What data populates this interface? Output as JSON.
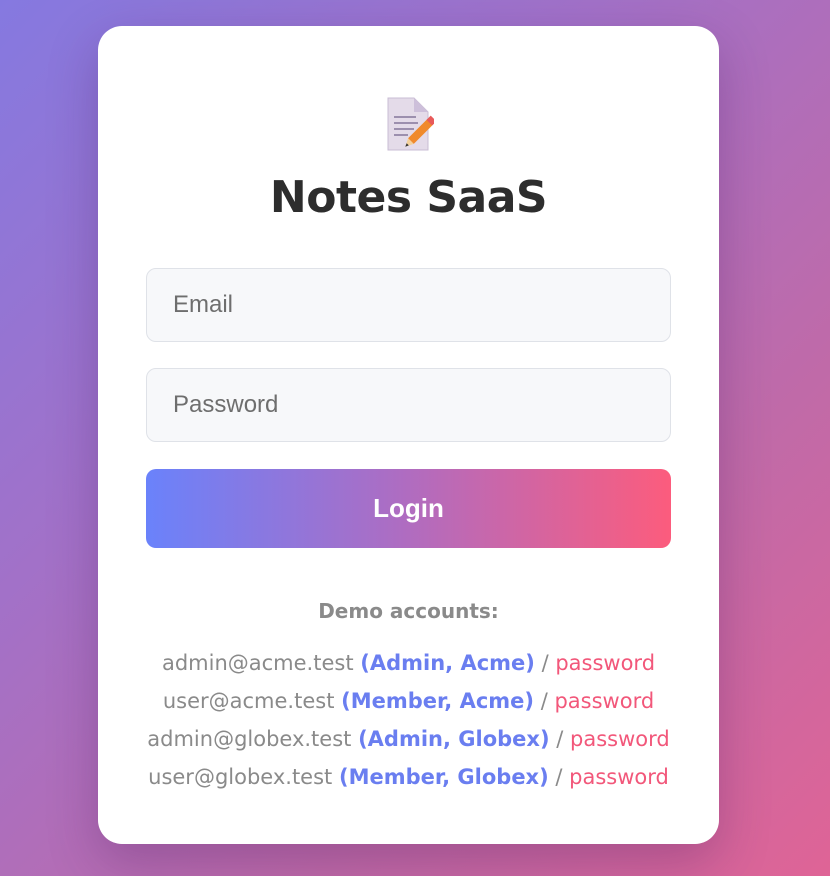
{
  "app": {
    "logo_icon": "memo-pencil-icon",
    "title": "Notes SaaS"
  },
  "form": {
    "email_placeholder": "Email",
    "password_placeholder": "Password",
    "login_label": "Login"
  },
  "demo": {
    "heading": "Demo accounts:",
    "separator": "/",
    "accounts": [
      {
        "email": "admin@acme.test",
        "role": "(Admin, Acme)",
        "password": "password"
      },
      {
        "email": "user@acme.test",
        "role": "(Member, Acme)",
        "password": "password"
      },
      {
        "email": "admin@globex.test",
        "role": "(Admin, Globex)",
        "password": "password"
      },
      {
        "email": "user@globex.test",
        "role": "(Member, Globex)",
        "password": "password"
      }
    ]
  },
  "colors": {
    "background_start": "#8579e0",
    "background_end": "#df6496",
    "button_start": "#6a82fb",
    "button_end": "#fc5c7d",
    "role_color": "#6a7ef0",
    "password_color": "#f2577a"
  }
}
